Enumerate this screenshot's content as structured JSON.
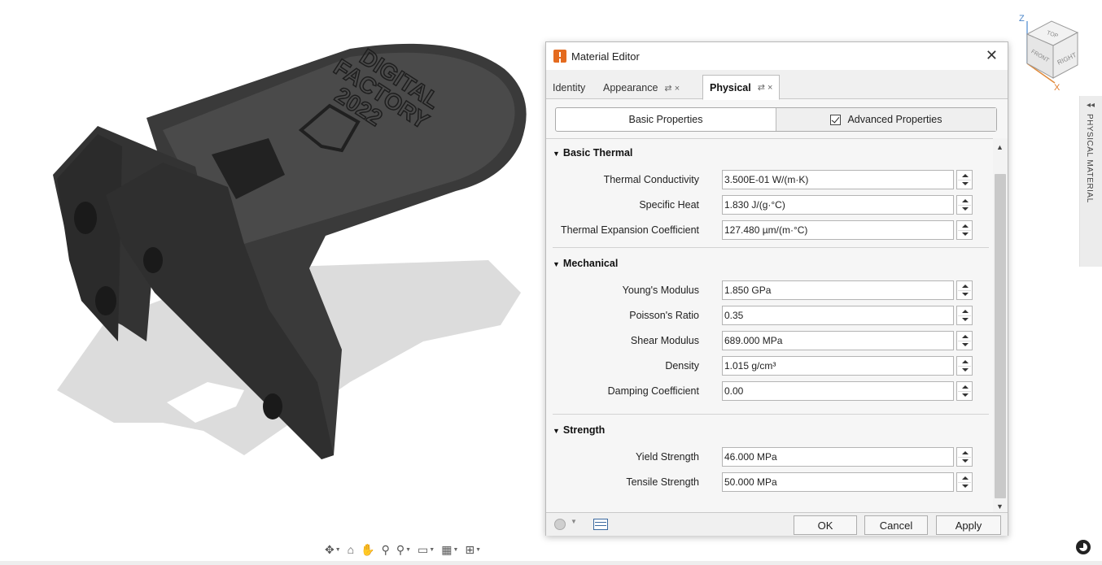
{
  "dialog": {
    "title": "Material Editor",
    "close_glyph": "✕",
    "tabs": [
      {
        "label": "Identity"
      },
      {
        "label": "Appearance",
        "icons": "⇄ ×"
      },
      {
        "label": "Physical",
        "icons": "⇄ ×"
      }
    ],
    "subtabs": {
      "basic": "Basic Properties",
      "advanced": "Advanced Properties",
      "advanced_checked": true
    },
    "sections": [
      {
        "title": "Basic Thermal",
        "properties": [
          {
            "label": "Thermal Conductivity",
            "value": "3.500E-01 W/(m·K)"
          },
          {
            "label": "Specific Heat",
            "value": "1.830 J/(g·°C)"
          },
          {
            "label": "Thermal Expansion Coefficient",
            "value": "127.480 µm/(m·°C)"
          }
        ]
      },
      {
        "title": "Mechanical",
        "properties": [
          {
            "label": "Young's Modulus",
            "value": "1.850 GPa"
          },
          {
            "label": "Poisson's Ratio",
            "value": "0.35"
          },
          {
            "label": "Shear Modulus",
            "value": "689.000 MPa"
          },
          {
            "label": "Density",
            "value": "1.015 g/cm³"
          },
          {
            "label": "Damping Coefficient",
            "value": "0.00"
          }
        ]
      },
      {
        "title": "Strength",
        "properties": [
          {
            "label": "Yield Strength",
            "value": "46.000 MPa"
          },
          {
            "label": "Tensile Strength",
            "value": "50.000 MPa"
          }
        ]
      }
    ],
    "footer": {
      "ok": "OK",
      "cancel": "Cancel",
      "apply": "Apply"
    }
  },
  "side_panel": {
    "arrows": "◂◂",
    "label": "PHYSICAL MATERIAL"
  },
  "viewcube": {
    "axis_z": "Z",
    "axis_x": "X",
    "face_top": "TOP",
    "face_front": "FRONT",
    "face_right": "RIGHT"
  },
  "model": {
    "engraving": [
      "DIGITAL",
      "FACTORY",
      "2022"
    ],
    "color": "#3a3a3a"
  },
  "nav_toolbar": [
    {
      "icon": "orbit-icon",
      "glyph": "✥",
      "caret": true
    },
    {
      "icon": "look-at-icon",
      "glyph": "⌂",
      "caret": false
    },
    {
      "icon": "pan-icon",
      "glyph": "✋",
      "caret": false
    },
    {
      "icon": "zoom-icon",
      "glyph": "⚲",
      "caret": false
    },
    {
      "icon": "zoom-window-icon",
      "glyph": "⚲",
      "caret": true
    },
    {
      "icon": "display-settings-icon",
      "glyph": "▭",
      "caret": true
    },
    {
      "icon": "grid-icon",
      "glyph": "▦",
      "caret": true
    },
    {
      "icon": "viewports-icon",
      "glyph": "⊞",
      "caret": true
    }
  ]
}
